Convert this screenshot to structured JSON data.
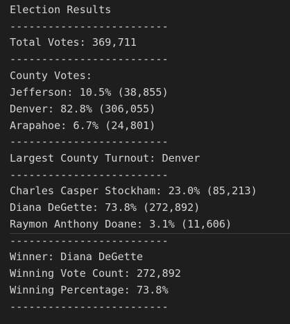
{
  "output": {
    "lines": [
      "Election Results",
      "-------------------------",
      "Total Votes: 369,711",
      "-------------------------",
      "County Votes:",
      "Jefferson: 10.5% (38,855)",
      "Denver: 82.8% (306,055)",
      "Arapahoe: 6.7% (24,801)",
      "-------------------------",
      "Largest County Turnout: Denver",
      "-------------------------",
      "Charles Casper Stockham: 23.0% (85,213)",
      "Diana DeGette: 73.8% (272,892)",
      "Raymon Anthony Doane: 3.1% (11,606)",
      "-------------------------",
      "Winner: Diana DeGette",
      "Winning Vote Count: 272,892",
      "Winning Percentage: 73.8%",
      "-------------------------"
    ]
  },
  "colors": {
    "background": "#1e1e1e",
    "text": "#d4d4d4"
  }
}
